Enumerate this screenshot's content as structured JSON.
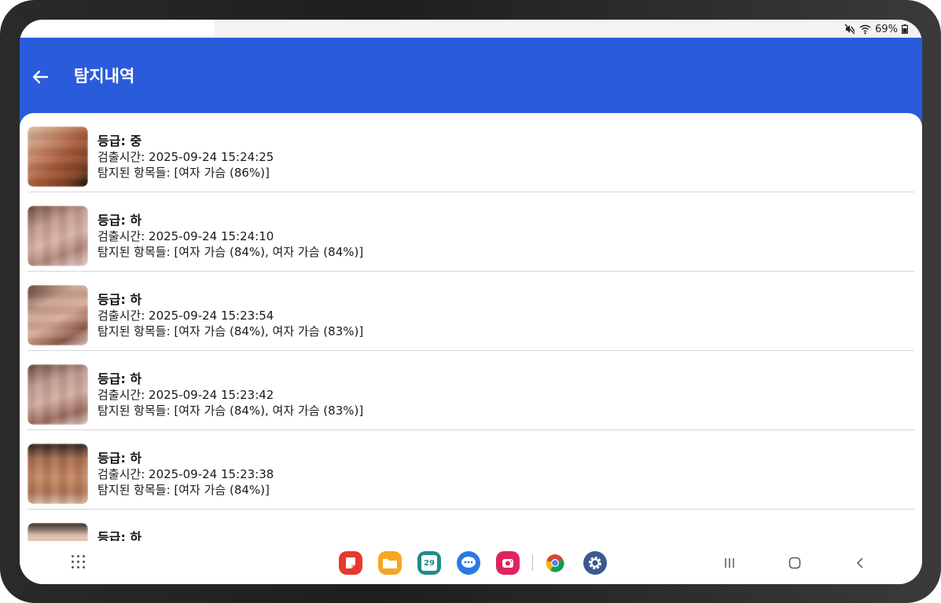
{
  "status": {
    "battery": "69%"
  },
  "header": {
    "title": "탐지내역"
  },
  "items": [
    {
      "grade": "등급: 중",
      "time": "검출시간: 2025-09-24 15:24:25",
      "detected": "탐지된 항목들: [여자 가슴 (86%)]"
    },
    {
      "grade": "등급: 하",
      "time": "검출시간: 2025-09-24 15:24:10",
      "detected": "탐지된 항목들: [여자 가슴 (84%), 여자 가슴 (84%)]"
    },
    {
      "grade": "등급: 하",
      "time": "검출시간: 2025-09-24 15:23:54",
      "detected": "탐지된 항목들: [여자 가슴 (84%), 여자 가슴 (83%)]"
    },
    {
      "grade": "등급: 하",
      "time": "검출시간: 2025-09-24 15:23:42",
      "detected": "탐지된 항목들: [여자 가슴 (84%), 여자 가슴 (83%)]"
    },
    {
      "grade": "등급: 하",
      "time": "검출시간: 2025-09-24 15:23:38",
      "detected": "탐지된 항목들: [여자 가슴 (84%)]"
    },
    {
      "grade": "등급: 하",
      "time": "",
      "detected": ""
    }
  ],
  "dock": {
    "calendar_day": "29"
  },
  "colors": {
    "appbar": "#2a5bdb",
    "divider": "#d6d6d6"
  }
}
